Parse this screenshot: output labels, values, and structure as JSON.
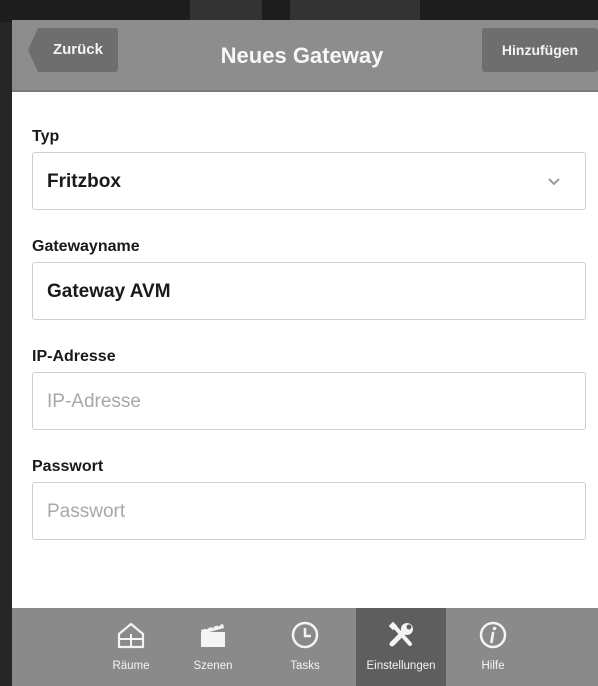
{
  "header": {
    "back_label": "Zurück",
    "title": "Neues Gateway",
    "add_label": "Hinzufügen"
  },
  "form": {
    "type": {
      "label": "Typ",
      "value": "Fritzbox"
    },
    "gateway_name": {
      "label": "Gatewayname",
      "value": "Gateway AVM"
    },
    "ip_address": {
      "label": "IP-Adresse",
      "placeholder": "IP-Adresse"
    },
    "password": {
      "label": "Passwort",
      "placeholder": "Passwort"
    }
  },
  "tabbar": {
    "items": [
      {
        "label": "Räume",
        "icon": "house-icon"
      },
      {
        "label": "Szenen",
        "icon": "clapperboard-icon"
      },
      {
        "label": "Tasks",
        "icon": "clock-icon"
      },
      {
        "label": "Einstellungen",
        "icon": "tools-icon",
        "active": true
      },
      {
        "label": "Hilfe",
        "icon": "info-icon"
      }
    ]
  },
  "colors": {
    "header_bg": "#8d8d8d",
    "button_bg": "#6e6e6e",
    "tabbar_bg": "#8a8a8a",
    "tab_active_bg": "#5e5e5e"
  }
}
